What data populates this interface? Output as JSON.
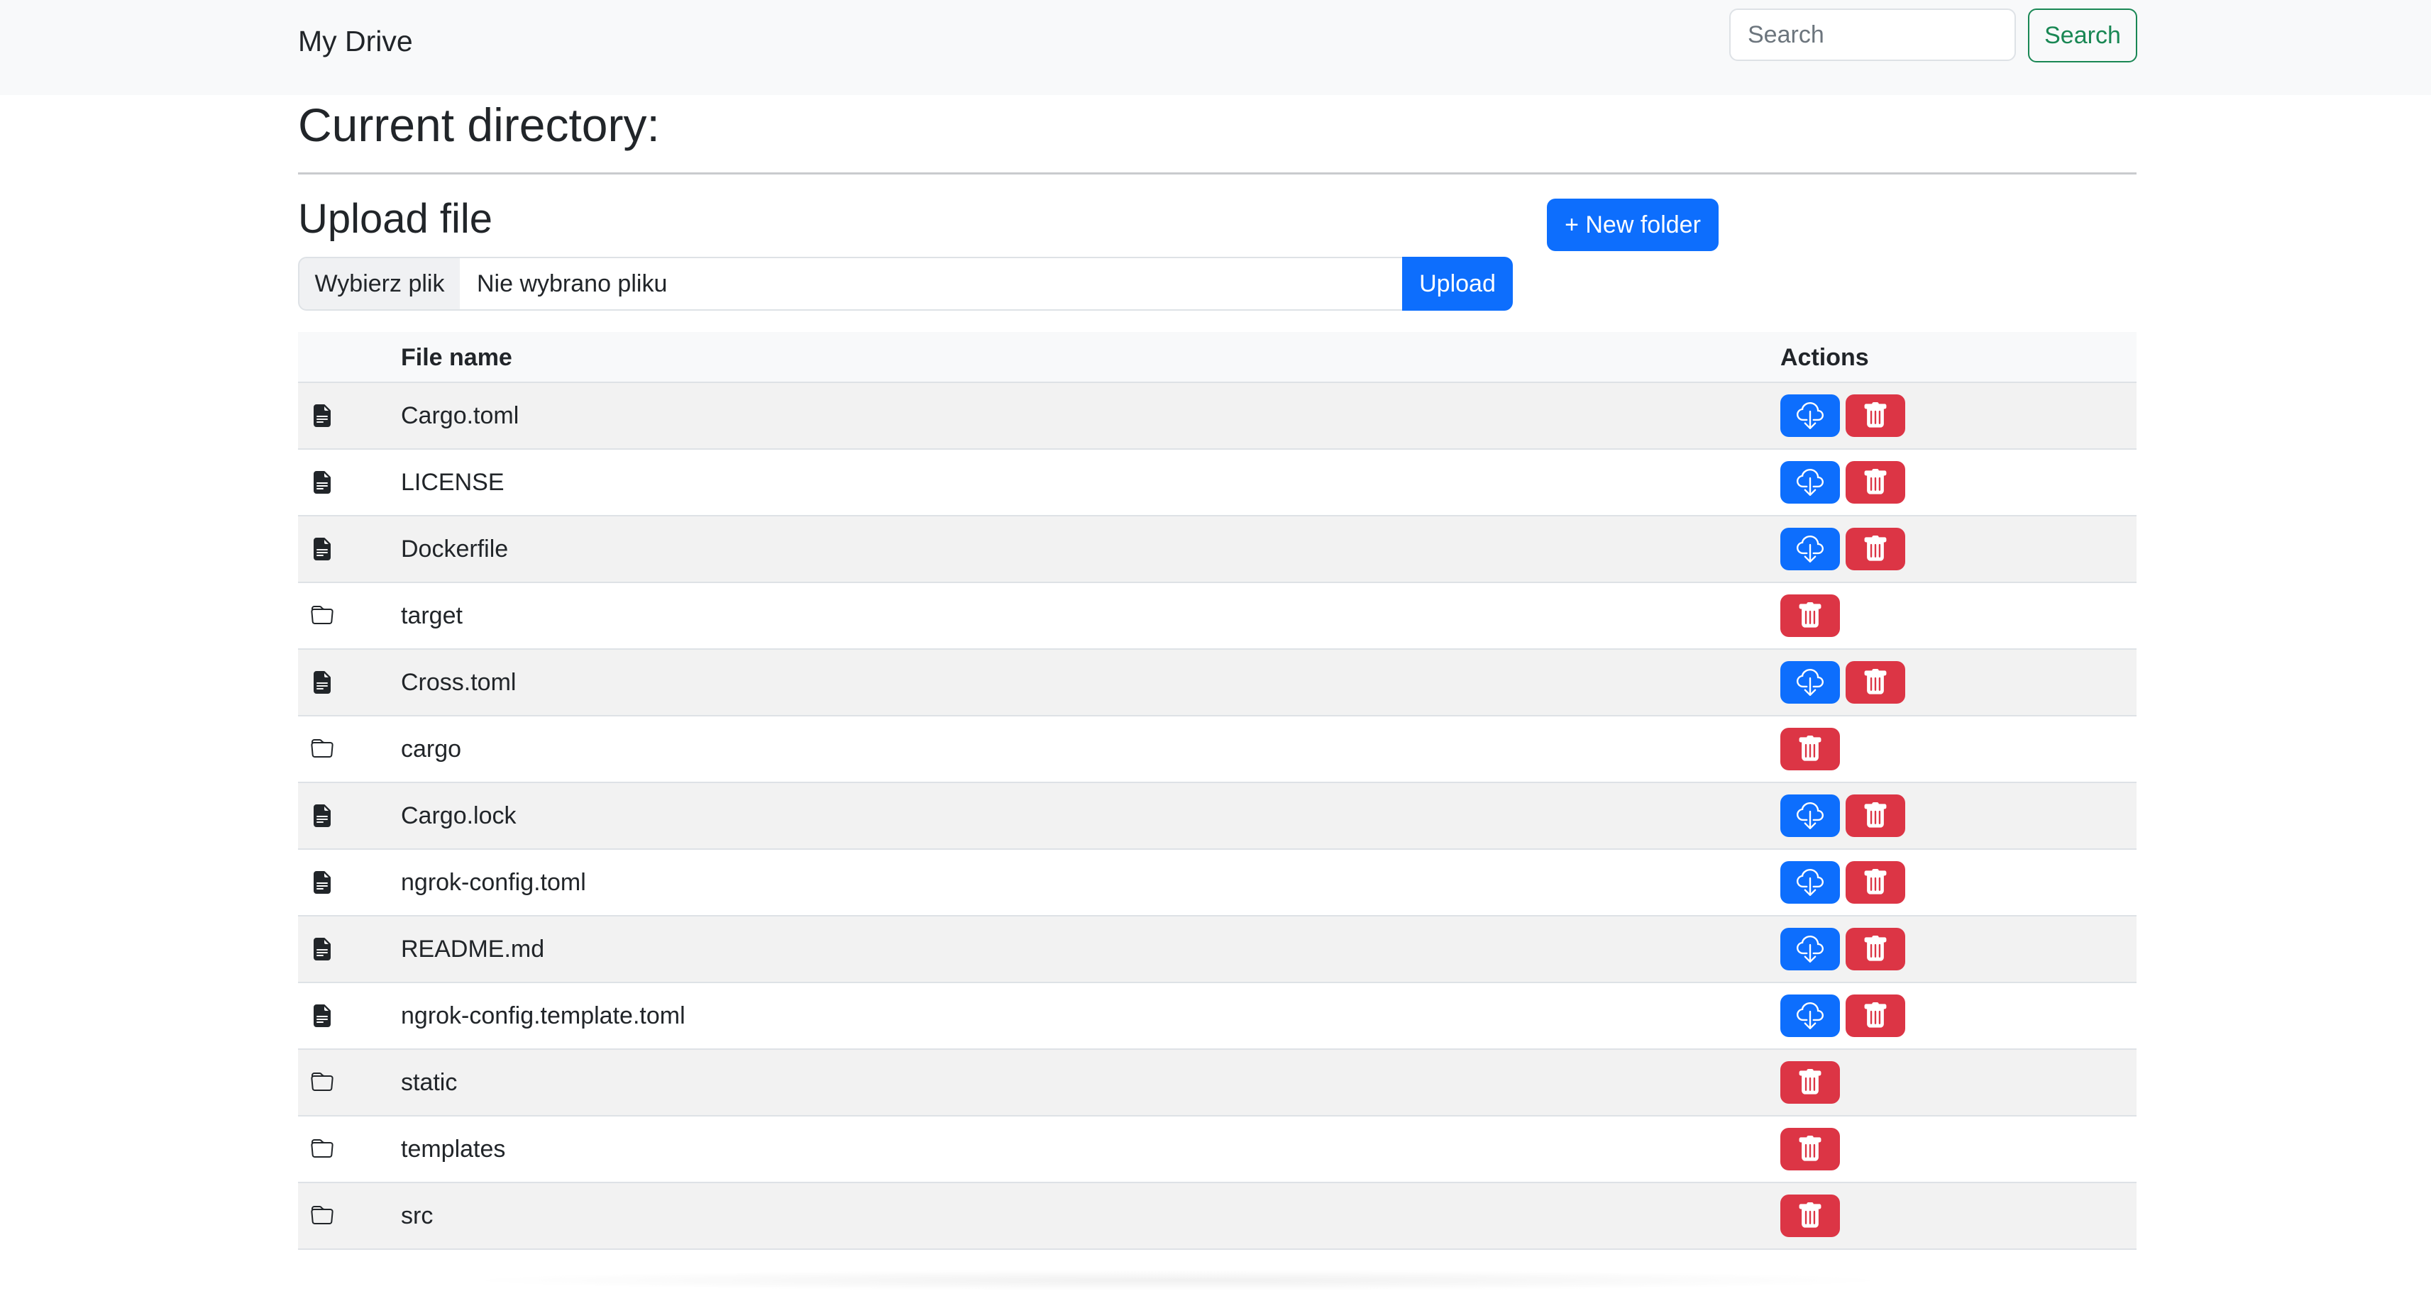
{
  "navbar": {
    "brand": "My Drive",
    "search_placeholder": "Search",
    "search_button": "Search"
  },
  "current_directory": {
    "heading": "Current directory:"
  },
  "upload": {
    "heading": "Upload file",
    "choose_button": "Wybierz plik",
    "no_file_text": "Nie wybrano pliku",
    "upload_button": "Upload",
    "new_folder_button": "+ New folder"
  },
  "table": {
    "columns": [
      "",
      "File name",
      "Actions"
    ],
    "rows": [
      {
        "type": "file",
        "name": "Cargo.toml",
        "actions": [
          "download",
          "delete"
        ]
      },
      {
        "type": "file",
        "name": "LICENSE",
        "actions": [
          "download",
          "delete"
        ]
      },
      {
        "type": "file",
        "name": "Dockerfile",
        "actions": [
          "download",
          "delete"
        ]
      },
      {
        "type": "folder",
        "name": "target",
        "actions": [
          "delete"
        ]
      },
      {
        "type": "file",
        "name": "Cross.toml",
        "actions": [
          "download",
          "delete"
        ]
      },
      {
        "type": "folder",
        "name": "cargo",
        "actions": [
          "delete"
        ]
      },
      {
        "type": "file",
        "name": "Cargo.lock",
        "actions": [
          "download",
          "delete"
        ]
      },
      {
        "type": "file",
        "name": "ngrok-config.toml",
        "actions": [
          "download",
          "delete"
        ]
      },
      {
        "type": "file",
        "name": "README.md",
        "actions": [
          "download",
          "delete"
        ]
      },
      {
        "type": "file",
        "name": "ngrok-config.template.toml",
        "actions": [
          "download",
          "delete"
        ]
      },
      {
        "type": "folder",
        "name": "static",
        "actions": [
          "delete"
        ]
      },
      {
        "type": "folder",
        "name": "templates",
        "actions": [
          "delete"
        ]
      },
      {
        "type": "folder",
        "name": "src",
        "actions": [
          "delete"
        ]
      }
    ]
  },
  "icons": {
    "file": "file-text-icon",
    "folder": "folder-icon",
    "download": "cloud-download-icon",
    "delete": "trash-icon"
  },
  "colors": {
    "primary": "#0d6efd",
    "danger": "#dc3545",
    "success": "#198754",
    "navbar_bg": "#f8f9fa",
    "stripe": "#f2f2f2"
  }
}
